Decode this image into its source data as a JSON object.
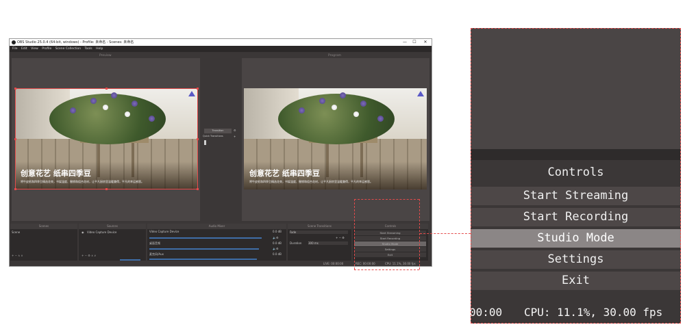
{
  "window": {
    "title": "OBS Studio 25.0.4 (64-bit, windows) - Profile: 未命名 - Scenes: 未命名",
    "min_glyph": "—",
    "max_glyph": "☐",
    "close_glyph": "✕"
  },
  "menu": [
    "File",
    "Edit",
    "View",
    "Profile",
    "Scene Collection",
    "Tools",
    "Help"
  ],
  "preview": {
    "label": "Preview",
    "caption": "创意花艺 纸串四季豆",
    "subcaption": "将牛皮纸和四季豆精选花束，书架温度、撤销和组合花材，让平凡厨房里温暖兼得，平凡的幸运感恩。"
  },
  "program": {
    "label": "Program",
    "caption": "创意花艺 纸串四季豆",
    "subcaption": "将牛皮纸和四季豆精选花束，书架温度、撤销和组合花材，让平凡厨房里温暖兼得，平凡的幸运感恩。"
  },
  "transition_center": {
    "button": "Transition",
    "quick": "Quick Transitions"
  },
  "docks": {
    "scenes": {
      "title": "Scenes",
      "item": "Scene"
    },
    "sources": {
      "title": "Sources",
      "item": "Video Capture Device"
    },
    "mixer": {
      "title": "Audio Mixer",
      "channels": [
        {
          "name": "Video Capture Device",
          "db": "0.0 dB",
          "level": 0.92
        },
        {
          "name": "桌面音频",
          "db": "0.0 dB",
          "level": 0.9
        },
        {
          "name": "麦克风/Aux",
          "db": "0.0 dB",
          "level": 0.88
        }
      ]
    },
    "scene_transitions": {
      "title": "Scene Transitions",
      "type": "Fade",
      "duration_label": "Duration",
      "duration_value": "300 ms"
    },
    "controls": {
      "title": "Controls",
      "buttons": [
        "Start Streaming",
        "Start Recording",
        "Studio Mode",
        "Settings",
        "Exit"
      ]
    }
  },
  "statusbar": {
    "live": "LIVE: 00:00:00",
    "rec": "REC: 00:00:00",
    "cpu": "CPU: 11.1%, 30.00 fps"
  },
  "zoom": {
    "title": "Controls",
    "buttons": [
      {
        "label": "Start Streaming",
        "active": false
      },
      {
        "label": "Start Recording",
        "active": false
      },
      {
        "label": "Studio Mode",
        "active": true
      },
      {
        "label": "Settings",
        "active": false
      },
      {
        "label": "Exit",
        "active": false
      }
    ],
    "status_time": "00:00",
    "status_cpu": "CPU: 11.1%, 30.00 fps"
  },
  "colors": {
    "highlight": "#e44b4b",
    "window_bg": "#3b3737",
    "active_button": "#8b8686"
  }
}
